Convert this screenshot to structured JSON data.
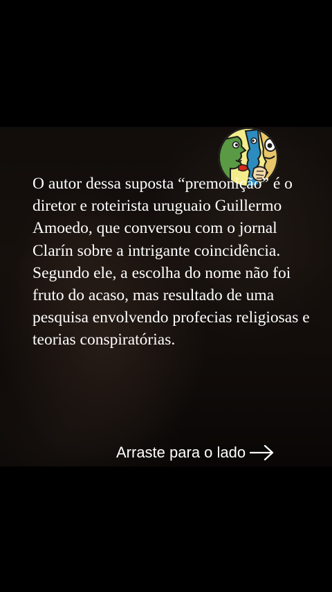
{
  "post": {
    "body_text": "O autor dessa suposta “premonição” é o diretor e roteirista uruguaio Guillermo Amoedo, que conversou com o jornal Clarín sobre a intrigante coincidência. Segundo ele, a escolha do nome não foi fruto do acaso, mas resultado de uma pesquisa envolvendo profecias religiosas e teorias conspiratórias."
  },
  "cta": {
    "label": "Arraste para o lado",
    "icon": "arrow-right-icon"
  },
  "logo": {
    "icon": "cartoon-faces-logo-icon",
    "background_color": "#f3ec8c",
    "accent_colors": [
      "#5a9a45",
      "#2c8cc0",
      "#d42a1c"
    ]
  },
  "colors": {
    "page_background": "#000000",
    "text": "#ffffff"
  }
}
